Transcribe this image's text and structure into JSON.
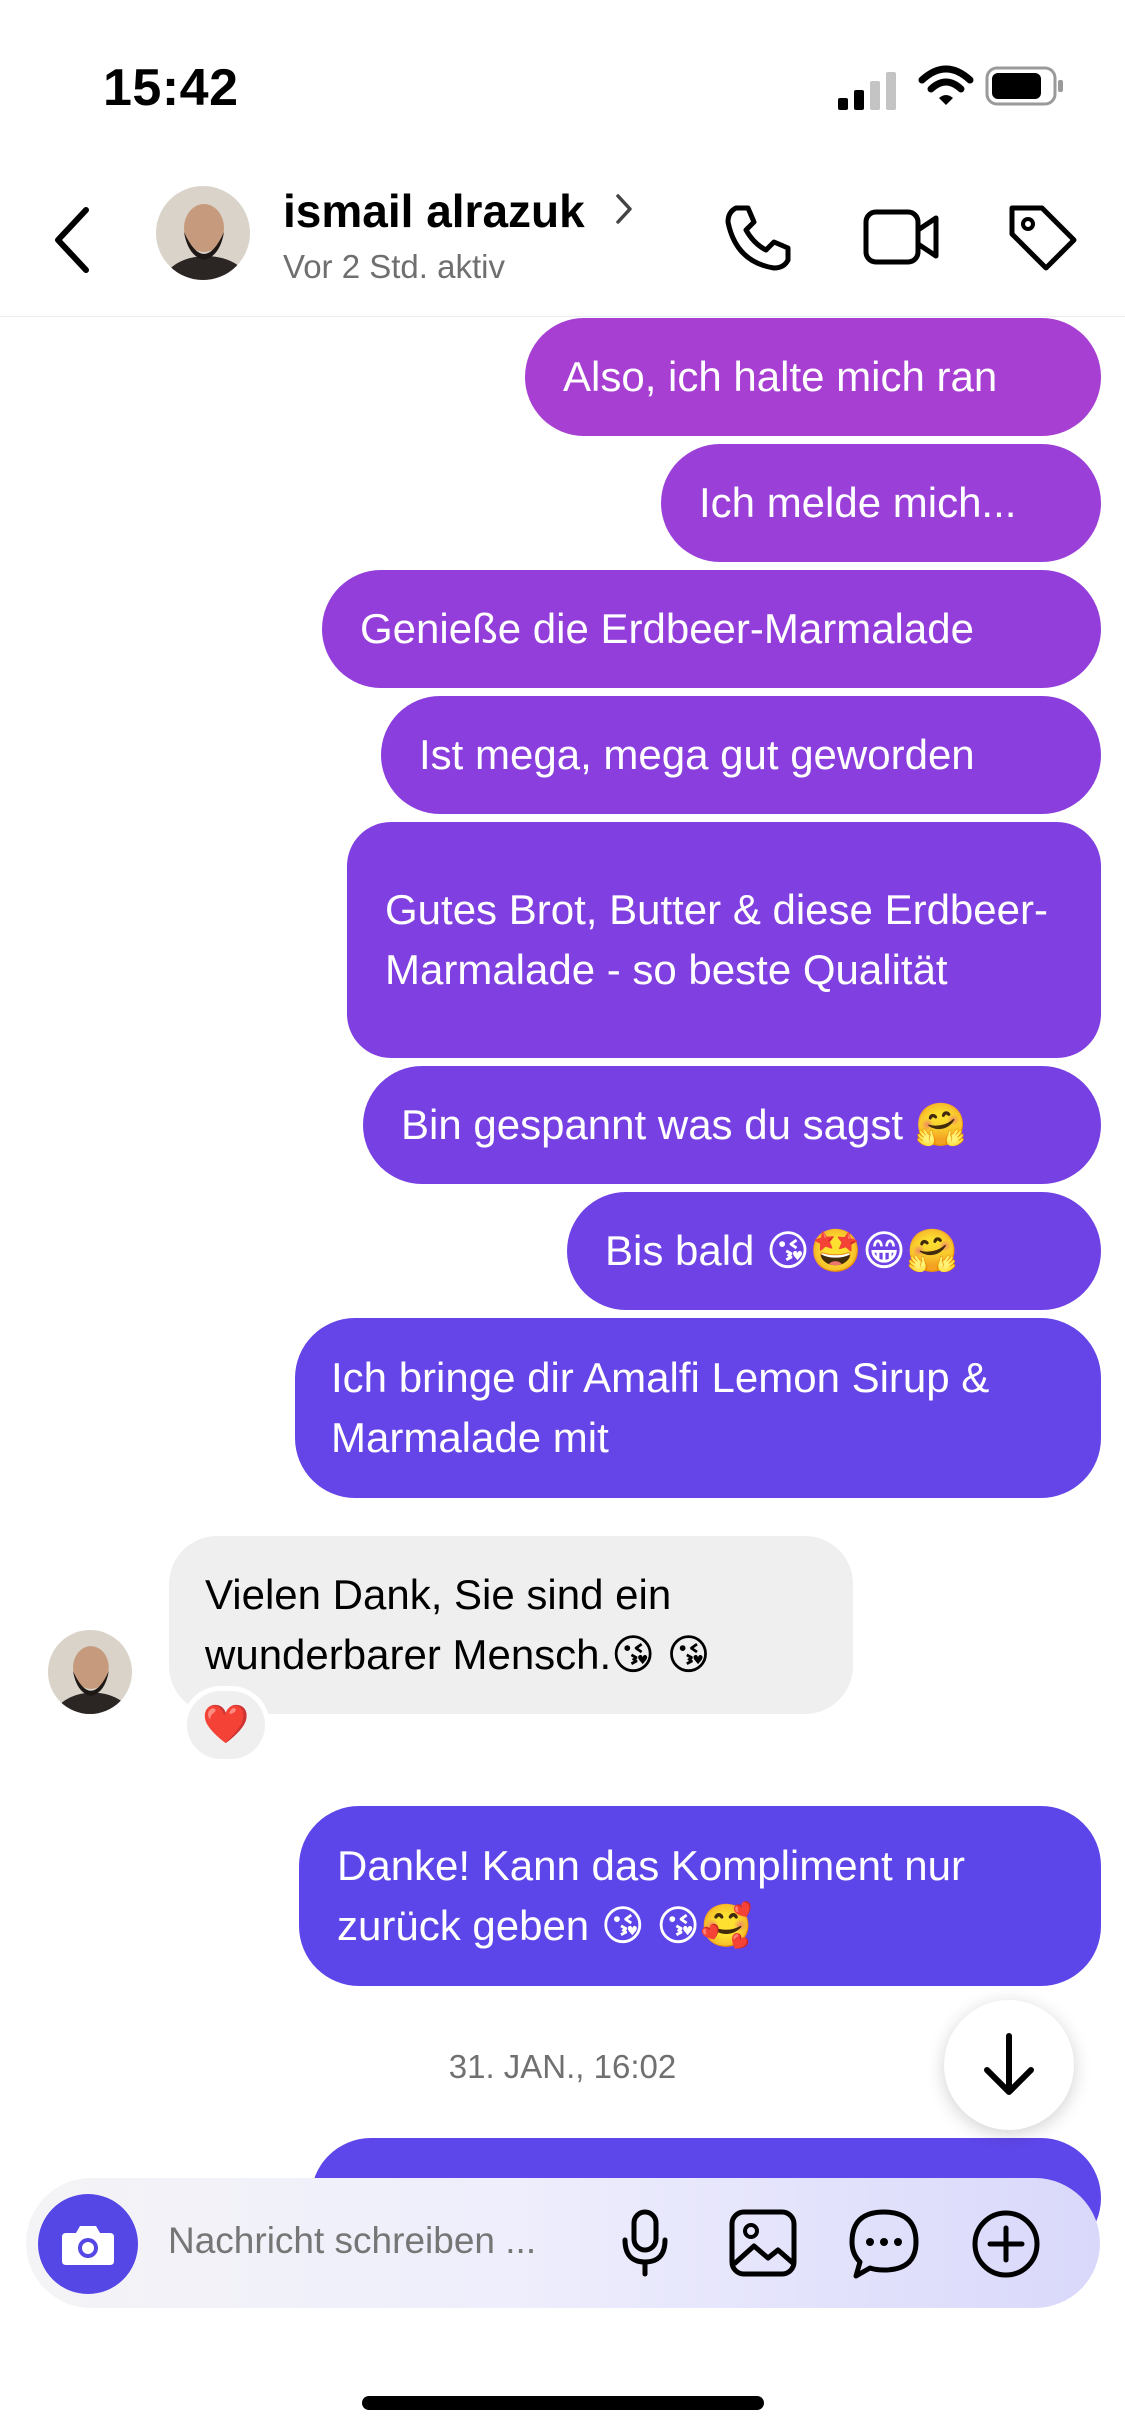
{
  "status_bar": {
    "time": "15:42"
  },
  "header": {
    "contact_name": "ismail alrazuk",
    "activity_status": "Vor 2 Std. aktiv"
  },
  "messages": [
    {
      "direction": "outgoing",
      "text": "Also, ich halte mich ran",
      "color": "#a73fd2"
    },
    {
      "direction": "outgoing",
      "text": "Ich melde mich...",
      "color": "#9b3fd9"
    },
    {
      "direction": "outgoing",
      "text": "Genieße die Erdbeer-Marmalade",
      "color": "#933edb"
    },
    {
      "direction": "outgoing",
      "text": "Ist mega, mega gut geworden",
      "color": "#8a3edd"
    },
    {
      "direction": "outgoing",
      "text": "Gutes Brot, Butter & diese Erdbeer-Marmalade - so beste Qualität",
      "color": "#803fe0"
    },
    {
      "direction": "outgoing",
      "text": "Bin gespannt was du sagst 🤗",
      "color": "#7740e3"
    },
    {
      "direction": "outgoing",
      "text": "Bis bald 😘🤩😁🤗",
      "color": "#6f42e5"
    },
    {
      "direction": "outgoing",
      "text": "Ich bringe dir Amalfi Lemon Sirup & Marmalade mit",
      "color": "#6544e8"
    },
    {
      "direction": "incoming",
      "text": "Vielen Dank, Sie sind ein wunderbarer Mensch.😘 😘",
      "reaction": "❤️"
    },
    {
      "direction": "outgoing",
      "text": "Danke! Kann das Kompliment nur zurück geben 😘 😘🥰",
      "color": "#5c46ea"
    }
  ],
  "date_separator": "31. JAN., 16:02",
  "composer": {
    "placeholder": "Nachricht schreiben ..."
  },
  "colors": {
    "accent": "#5547e6",
    "incoming_bubble": "#efefef"
  },
  "icons": [
    "back-chevron",
    "phone",
    "video-camera",
    "tag",
    "camera",
    "microphone",
    "image",
    "sticker-bubble",
    "plus-circle",
    "arrow-down"
  ]
}
